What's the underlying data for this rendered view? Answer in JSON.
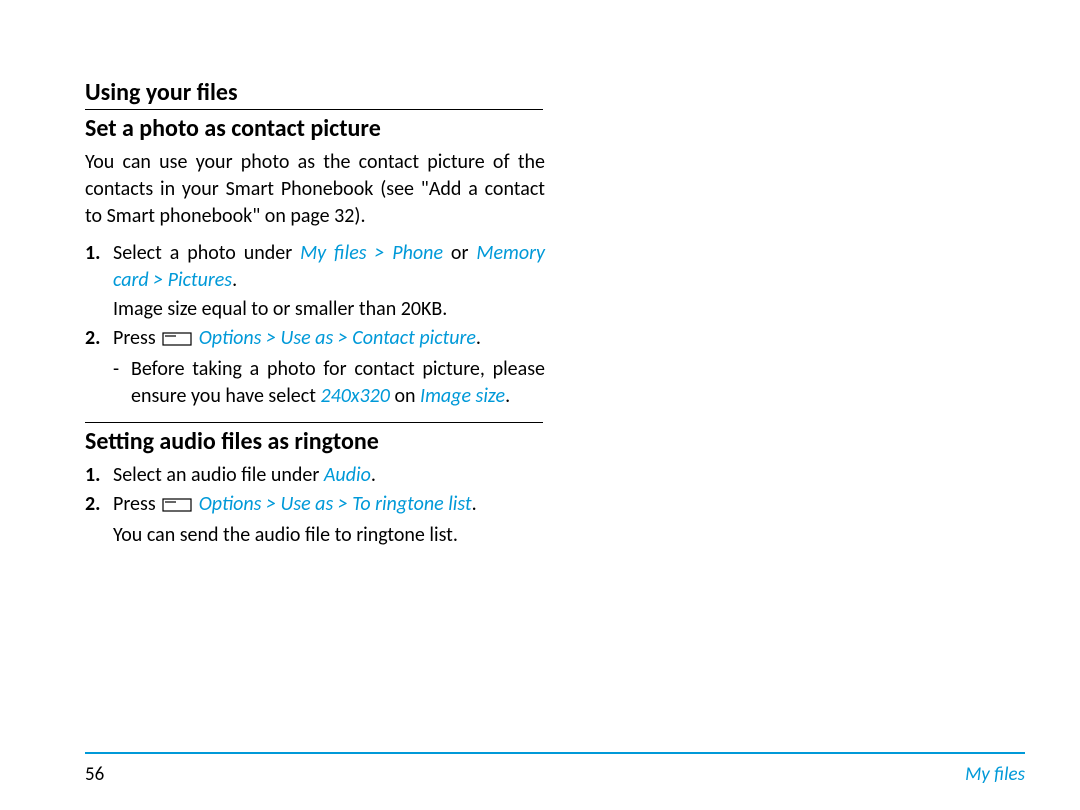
{
  "headings": {
    "h1": "Using your files",
    "h2a": "Set a photo as contact picture",
    "h2b": "Setting audio files as ringtone"
  },
  "section_a": {
    "intro": "You can use your photo as the contact picture of the contacts in your Smart Phonebook (see \"Add a contact to Smart phonebook\" on page 32).",
    "step1_pre": "Select a photo under ",
    "step1_kw1": "My files",
    "step1_sep1": " > ",
    "step1_kw2": "Phone",
    "step1_mid": " or ",
    "step1_kw3": "Memory card",
    "step1_sep2": " > ",
    "step1_kw4": "Pictures",
    "step1_end": ".",
    "step1_note": "Image size equal to or smaller than 20KB.",
    "step2_pre": "Press ",
    "step2_kw1": "Options",
    "step2_sep1": " > ",
    "step2_kw2": "Use as",
    "step2_sep2": " > ",
    "step2_kw3": "Contact picture",
    "step2_end": ".",
    "step2_dash_pre": "Before taking a photo for contact picture, please ensure you have select ",
    "step2_dash_kw1": "240x320",
    "step2_dash_mid": " on  ",
    "step2_dash_kw2": "Image size",
    "step2_dash_end": "."
  },
  "section_b": {
    "step1_pre": "Select an audio file under ",
    "step1_kw1": "Audio",
    "step1_end": ".",
    "step2_pre": "Press ",
    "step2_kw1": "Options",
    "step2_sep1": " > ",
    "step2_kw2": "Use as",
    "step2_sep2": " > ",
    "step2_kw3": "To ringtone list",
    "step2_end": ".",
    "step2_note": "You can send the audio file to ringtone list."
  },
  "footer": {
    "page": "56",
    "section": "My files"
  },
  "nums": {
    "one": "1.",
    "two": "2.",
    "dash": "-"
  }
}
